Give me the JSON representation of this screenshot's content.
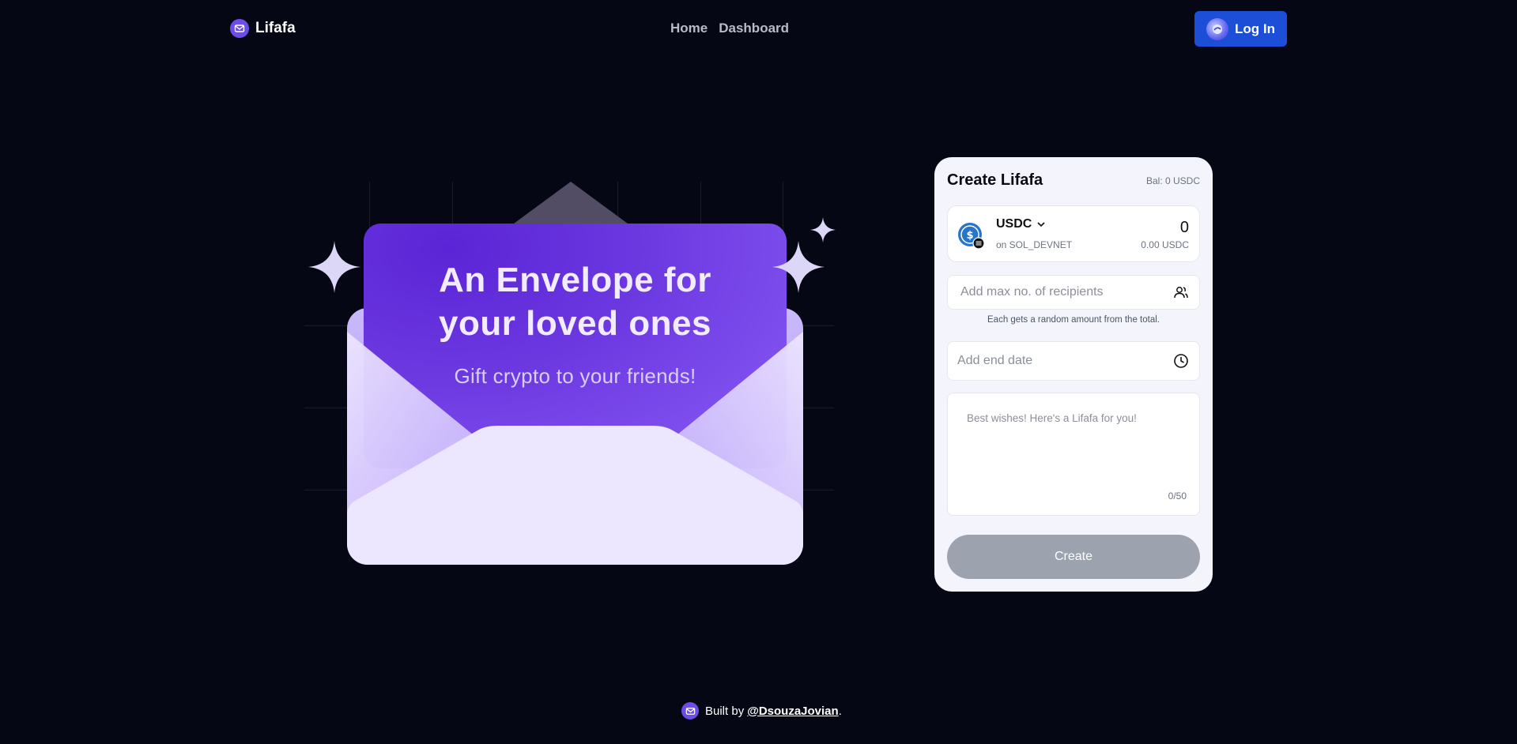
{
  "header": {
    "brand": "Lifafa",
    "nav": {
      "home": "Home",
      "dashboard": "Dashboard"
    },
    "login_label": "Log In"
  },
  "hero": {
    "title_line1": "An Envelope for",
    "title_line2": "your loved ones",
    "subtitle": "Gift crypto to your friends!"
  },
  "form": {
    "title": "Create Lifafa",
    "balance": "Bal: 0 USDC",
    "token": {
      "symbol": "USDC",
      "network": "on SOL_DEVNET",
      "amount": "0",
      "amount_usd": "0.00 USDC"
    },
    "recipients_placeholder": "Add max no. of recipients",
    "recipients_hint": "Each gets a random amount from the total.",
    "end_date_placeholder": "Add end date",
    "message_placeholder": "Best wishes! Here's a Lifafa for you!",
    "message_count": "0/50",
    "create_label": "Create"
  },
  "footer": {
    "built_by": "Built by",
    "handle": "@DsouzaJovian",
    "suffix": "."
  },
  "colors": {
    "background": "#050814",
    "accent": "#6d4dea",
    "login": "#1d4ed8",
    "create_disabled": "#9ca3af"
  }
}
